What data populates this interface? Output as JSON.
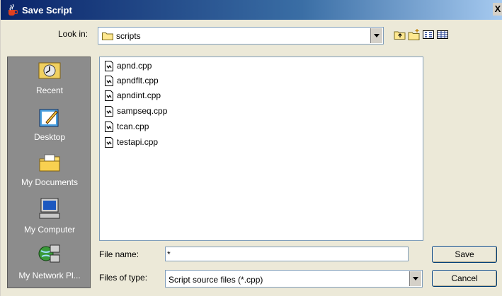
{
  "window": {
    "title": "Save Script",
    "close_label": "X"
  },
  "lookin": {
    "label": "Look in:",
    "value": "scripts"
  },
  "toolbar": {
    "icons": [
      "up-folder-icon",
      "new-folder-icon",
      "list-view-icon",
      "details-view-icon"
    ]
  },
  "places": {
    "items": [
      {
        "label": "Recent",
        "icon": "recent-icon"
      },
      {
        "label": "Desktop",
        "icon": "desktop-icon"
      },
      {
        "label": "My Documents",
        "icon": "my-documents-icon"
      },
      {
        "label": "My Computer",
        "icon": "my-computer-icon"
      },
      {
        "label": "My Network Pl...",
        "icon": "my-network-icon"
      }
    ]
  },
  "files": [
    {
      "name": "apnd.cpp"
    },
    {
      "name": "apndflt.cpp"
    },
    {
      "name": "apndint.cpp"
    },
    {
      "name": "sampseq.cpp"
    },
    {
      "name": "tcan.cpp"
    },
    {
      "name": "testapi.cpp"
    }
  ],
  "filename": {
    "label": "File name:",
    "value": "*"
  },
  "filetype": {
    "label": "Files of type:",
    "value": "Script source files (*.cpp)"
  },
  "buttons": {
    "save": "Save",
    "cancel": "Cancel"
  },
  "colors": {
    "title_bar": "#0a246a",
    "places_bg": "#8c8c8c",
    "dialog_bg": "#ece9d8"
  }
}
